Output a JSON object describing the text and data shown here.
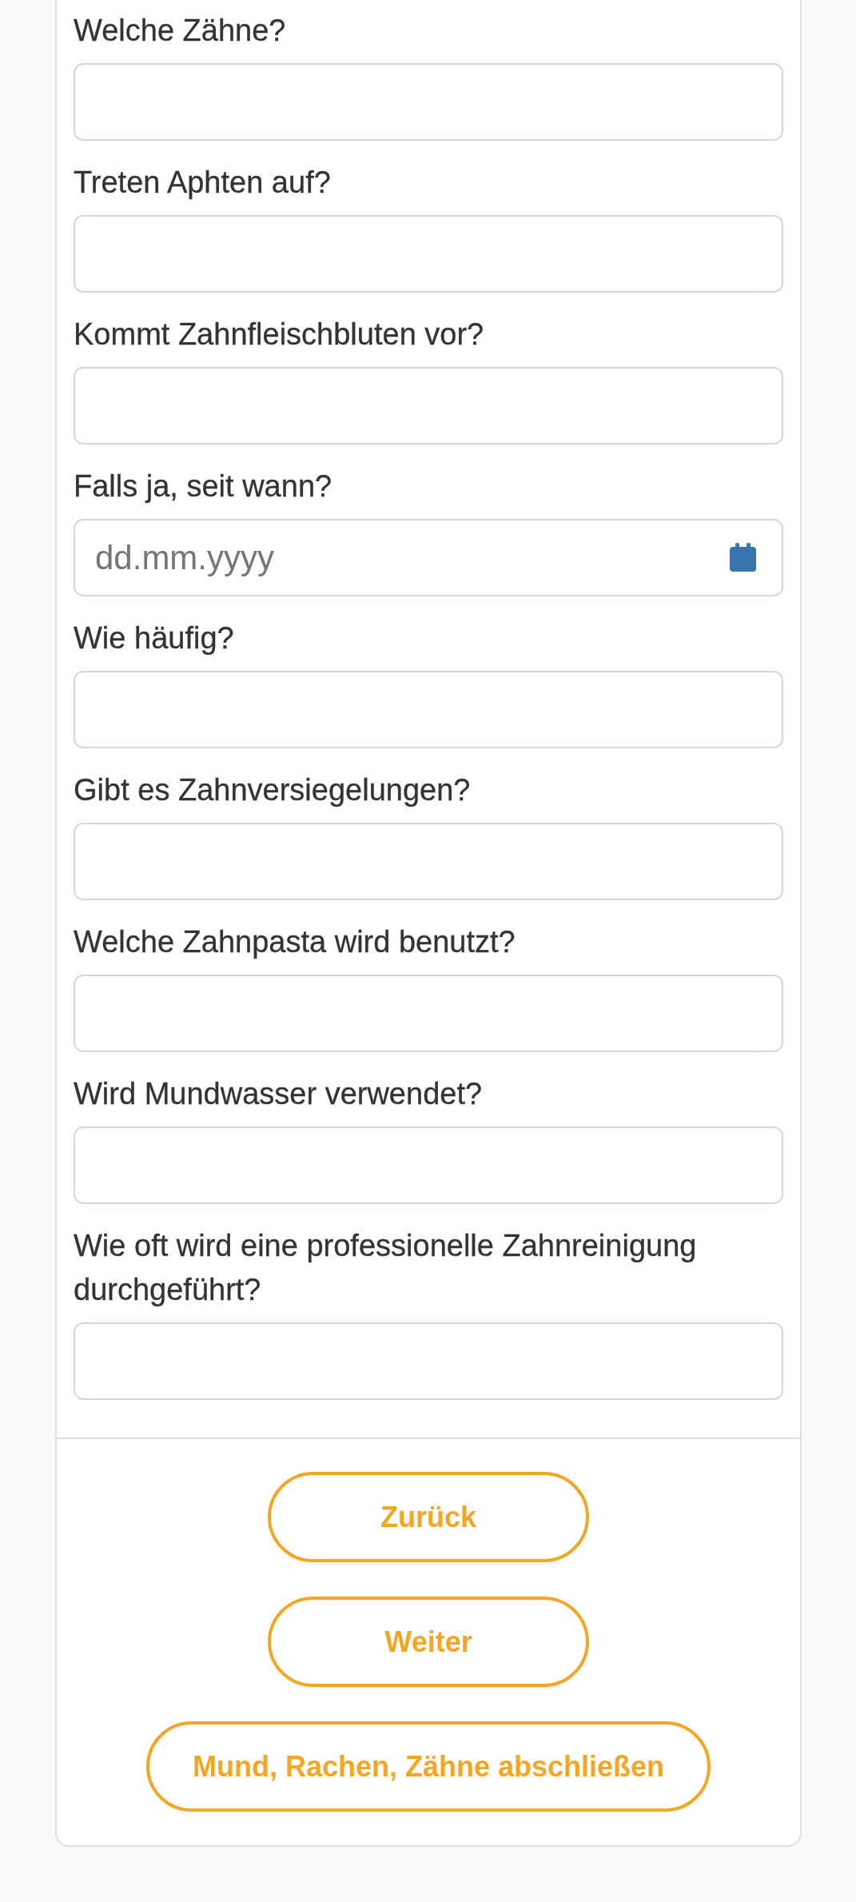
{
  "form": {
    "fields": [
      {
        "kind": "text",
        "label": "Welche Zähne?"
      },
      {
        "kind": "text",
        "label": "Treten Aphten auf?"
      },
      {
        "kind": "text",
        "label": "Kommt Zahnfleischbluten vor?"
      },
      {
        "kind": "date",
        "label": "Falls ja, seit wann?",
        "placeholder": "dd.mm.yyyy"
      },
      {
        "kind": "text",
        "label": "Wie häufig?"
      },
      {
        "kind": "text",
        "label": "Gibt es Zahnversiegelungen?"
      },
      {
        "kind": "text",
        "label": "Welche Zahnpasta wird benutzt?"
      },
      {
        "kind": "text",
        "label": "Wird Mundwasser verwendet?"
      },
      {
        "kind": "text",
        "label": "Wie oft wird eine professionelle Zahnreinigung durchgeführt?"
      }
    ]
  },
  "buttons": [
    "Zurück",
    "Weiter",
    "Mund, Rachen, Zähne abschließen"
  ]
}
